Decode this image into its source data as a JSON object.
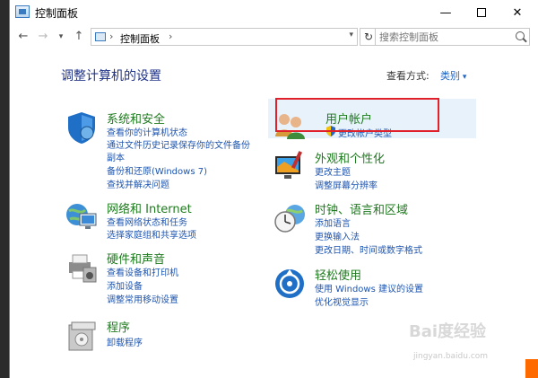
{
  "window": {
    "title": "控制面板"
  },
  "toolbar": {
    "breadcrumb": "控制面板",
    "search_placeholder": "搜索控制面板"
  },
  "header": {
    "page_title": "调整计算机的设置",
    "view_by_label": "查看方式:",
    "view_by_value": "类别"
  },
  "categories": [
    {
      "title": "系统和安全",
      "links": [
        "查看你的计算机状态",
        "通过文件历史记录保存你的文件备份",
        "副本",
        "备份和还原(Windows 7)",
        "查找并解决问题"
      ]
    },
    {
      "title": "网络和 Internet",
      "links": [
        "查看网络状态和任务",
        "选择家庭组和共享选项"
      ]
    },
    {
      "title": "硬件和声音",
      "links": [
        "查看设备和打印机",
        "添加设备",
        "调整常用移动设置"
      ]
    },
    {
      "title": "程序",
      "links": [
        "卸载程序"
      ]
    },
    {
      "title": "用户帐户",
      "links": [
        "更改帐户类型"
      ]
    },
    {
      "title": "外观和个性化",
      "links": [
        "更改主题",
        "调整屏幕分辨率"
      ]
    },
    {
      "title": "时钟、语言和区域",
      "links": [
        "添加语言",
        "更换输入法",
        "更改日期、时间或数字格式"
      ]
    },
    {
      "title": "轻松使用",
      "links": [
        "使用 Windows 建议的设置",
        "优化视觉显示"
      ]
    }
  ],
  "watermark": {
    "text": "Bai度经验",
    "sub": "jingyan.baidu.com"
  },
  "colors": {
    "category_title": "#1e7a1e",
    "link": "#1e55b0",
    "highlight": "#e0202a"
  }
}
